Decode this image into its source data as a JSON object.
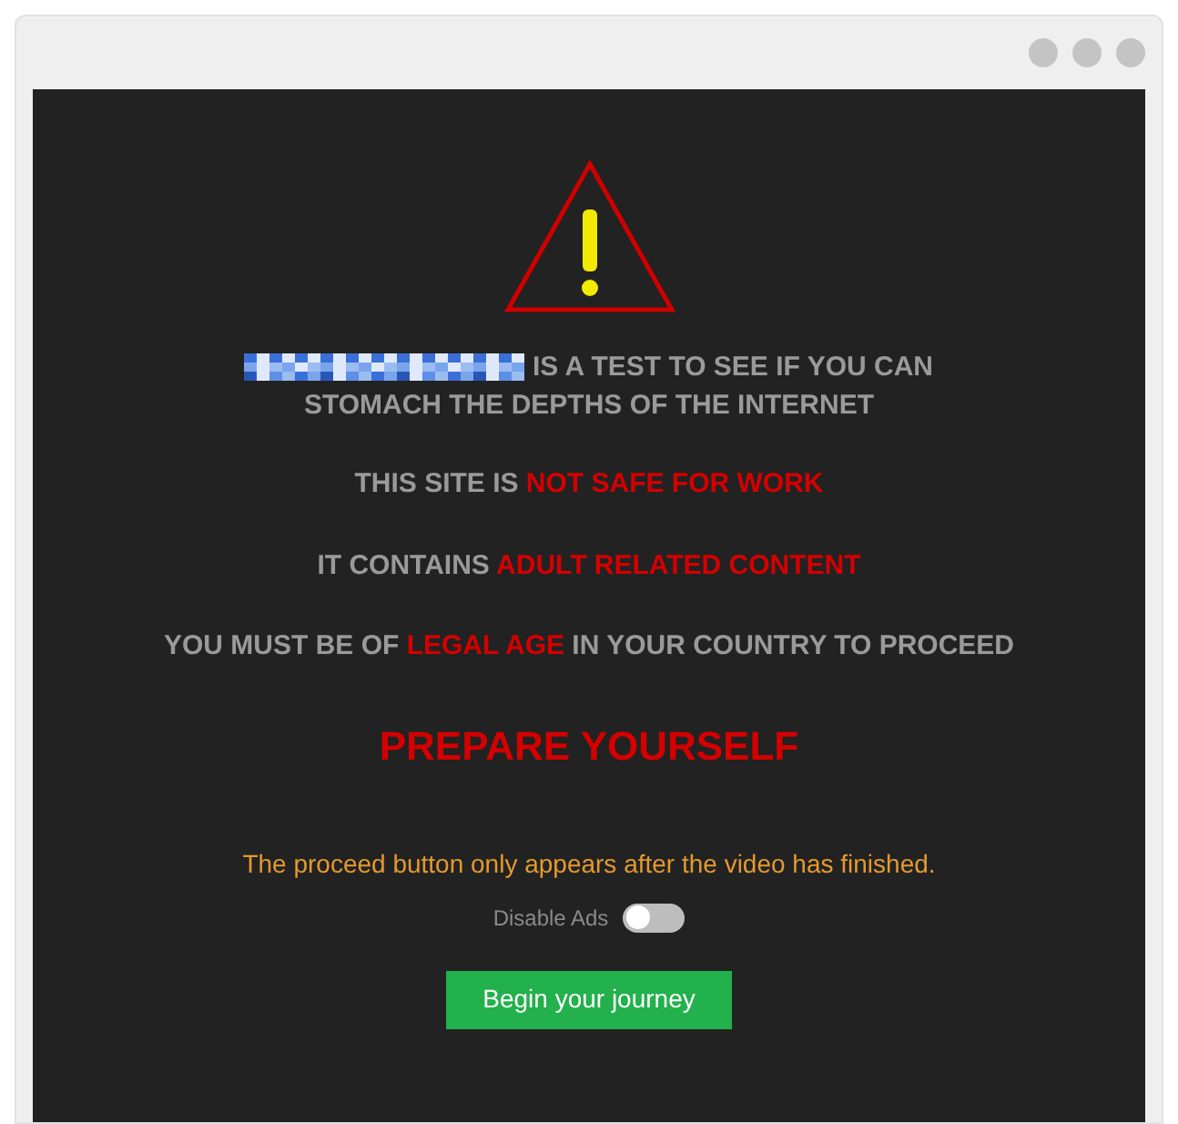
{
  "warning": {
    "intro": [
      "IS A TEST TO SEE IF YOU CAN",
      "STOMACH THE DEPTHS OF THE INTERNET"
    ],
    "lines": [
      {
        "parts": [
          {
            "text": "THIS SITE IS ",
            "highlight": false
          },
          {
            "text": "NOT SAFE FOR WORK",
            "highlight": true
          }
        ]
      },
      {
        "parts": [
          {
            "text": "IT CONTAINS ",
            "highlight": false
          },
          {
            "text": "ADULT RELATED CONTENT",
            "highlight": true
          }
        ]
      },
      {
        "parts": [
          {
            "text": "YOU MUST BE OF ",
            "highlight": false
          },
          {
            "text": "LEGAL AGE",
            "highlight": true
          },
          {
            "text": " IN YOUR COUNTRY TO PROCEED",
            "highlight": false
          }
        ]
      }
    ],
    "headline": "PREPARE YOURSELF"
  },
  "notice": "The proceed button only appears after the video has finished.",
  "toggle": {
    "label": "Disable Ads",
    "on": false
  },
  "button": "Begin your journey"
}
